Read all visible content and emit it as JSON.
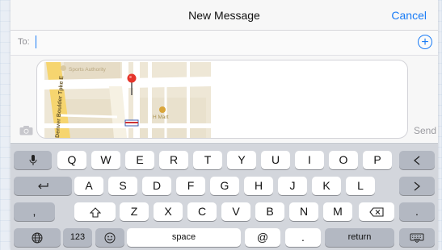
{
  "navbar": {
    "title": "New Message",
    "cancel": "Cancel"
  },
  "to_field": {
    "label": "To:",
    "value": "",
    "add_icon": "plus-circle-icon"
  },
  "compose": {
    "map": {
      "labels": [
        "Sports Authority",
        "Denver Boulder Tpke E",
        "H Mart"
      ],
      "pin_icon": "map-pin-icon"
    },
    "camera_icon": "camera-icon",
    "send": "Send"
  },
  "keyboard": {
    "row1": [
      "Q",
      "W",
      "E",
      "R",
      "T",
      "Y",
      "U",
      "I",
      "O",
      "P"
    ],
    "row2": [
      "A",
      "S",
      "D",
      "F",
      "G",
      "H",
      "J",
      "K",
      "L"
    ],
    "row3": [
      "Z",
      "X",
      "C",
      "V",
      "B",
      "N",
      "M"
    ],
    "comma": ",",
    "period": ".",
    "numbers": "123",
    "space": "space",
    "at": "@",
    "return": "return",
    "icons": [
      "microphone-icon",
      "left-arrow-icon",
      "undo-icon",
      "right-arrow-icon",
      "shift-icon",
      "delete-icon",
      "globe-icon",
      "emoji-icon",
      "keyboard-dismiss-icon"
    ]
  }
}
